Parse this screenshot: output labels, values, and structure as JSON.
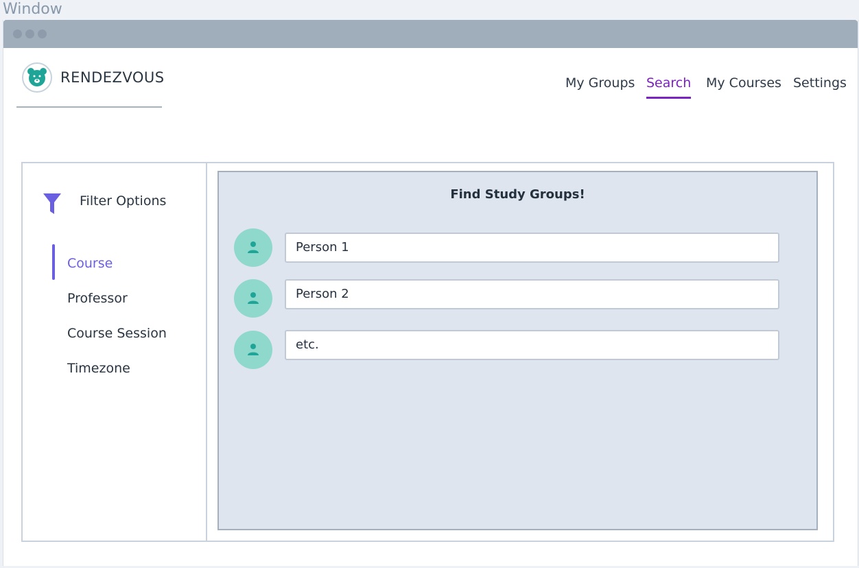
{
  "window": {
    "caption": "Window"
  },
  "brand": {
    "name": "RENDEZVOUS",
    "logo_icon": "bear-icon"
  },
  "nav": {
    "items": [
      {
        "label": "My Groups",
        "active": false
      },
      {
        "label": "Search",
        "active": true
      },
      {
        "label": "My Courses",
        "active": false
      },
      {
        "label": "Settings",
        "active": false
      }
    ]
  },
  "filters": {
    "title": "Filter Options",
    "icon": "filter-icon",
    "items": [
      {
        "label": "Course",
        "active": true
      },
      {
        "label": "Professor",
        "active": false
      },
      {
        "label": "Course Session",
        "active": false
      },
      {
        "label": "Timezone",
        "active": false
      }
    ]
  },
  "results": {
    "title": "Find Study Groups!",
    "people": [
      {
        "name": "Person 1",
        "icon": "user-icon"
      },
      {
        "name": "Person 2",
        "icon": "user-icon"
      },
      {
        "name": "etc.",
        "icon": "user-icon"
      }
    ]
  },
  "colors": {
    "accent": "#7a22c2",
    "filter_accent": "#6a5fe0",
    "avatar": "#8ed8cc",
    "avatar_icon": "#1fa597",
    "results_bg": "#dfe5ee"
  }
}
